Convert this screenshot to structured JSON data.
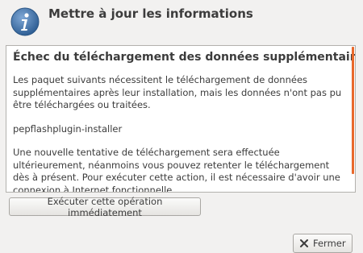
{
  "dialog": {
    "title": "Mettre à jour les informations",
    "icon": "info-icon"
  },
  "content": {
    "heading": "Échec du téléchargement des données supplémentaires",
    "paragraph1": "Les paquet suivants nécessitent le téléchargement de données supplémentaires après leur installation, mais les données n'ont pas pu être téléchargées ou traitées.",
    "package": "pepflashplugin-installer",
    "paragraph2": "Une nouvelle tentative de téléchargement sera effectuée ultérieurement, néanmoins vous pouvez retenter le téléchargement dès à présent. Pour exécuter cette action, il est nécessaire d'avoir une connexion à Internet fonctionnelle."
  },
  "buttons": {
    "run_now": "Exécuter cette opération immédiatement",
    "close": "Fermer"
  },
  "colors": {
    "accent": "#e9692c",
    "icon_blue": "#3a6ea5"
  }
}
